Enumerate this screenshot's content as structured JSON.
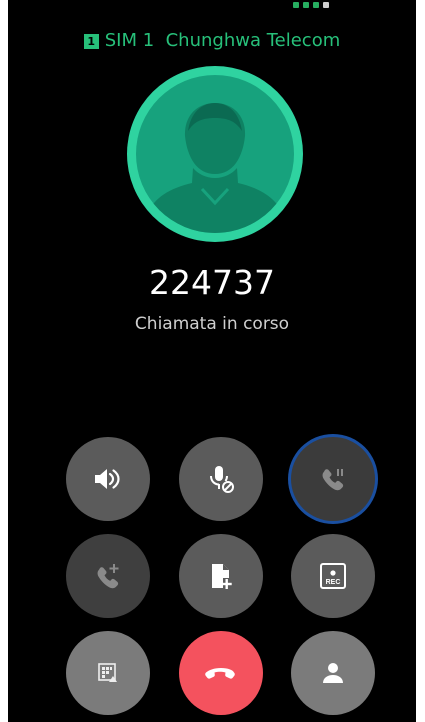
{
  "status_bar": {
    "partial": true
  },
  "sim": {
    "badge": "1",
    "label": "SIM 1  Chunghwa Telecom",
    "color": "#27c07a"
  },
  "contact": {
    "avatar_icon": "person-silhouette-icon",
    "number": "224737",
    "call_status": "Chiamata in corso"
  },
  "controls": [
    {
      "name": "speaker-button",
      "icon": "speaker-icon",
      "state": "normal"
    },
    {
      "name": "mute-button",
      "icon": "mic-off-icon",
      "state": "normal"
    },
    {
      "name": "hold-button",
      "icon": "call-hold-icon",
      "state": "focused"
    },
    {
      "name": "add-call-button",
      "icon": "add-call-icon",
      "state": "disabled"
    },
    {
      "name": "add-note-button",
      "icon": "add-note-icon",
      "state": "normal"
    },
    {
      "name": "record-button",
      "icon": "record-icon",
      "label": "REC",
      "state": "normal"
    },
    {
      "name": "dialpad-button",
      "icon": "dialpad-icon",
      "state": "normal"
    },
    {
      "name": "end-call-button",
      "icon": "hang-up-icon",
      "state": "danger"
    },
    {
      "name": "contacts-button",
      "icon": "contact-icon",
      "state": "normal"
    }
  ],
  "colors": {
    "accent": "#27c07a",
    "avatar_ring": "#2fd3a0",
    "avatar_fill": "#17a27d",
    "end_call": "#f4525e",
    "focus_ring": "#1a4fa0"
  }
}
